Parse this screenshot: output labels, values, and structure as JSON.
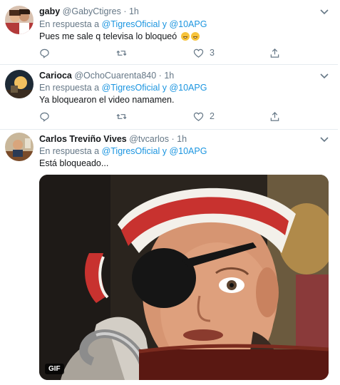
{
  "tweets": [
    {
      "name": "gaby",
      "handle": "@GabyCtigres",
      "dot": "·",
      "time": "1h",
      "reply_prefix": "En respuesta a ",
      "reply_links": "@TigresOficial y @10APG",
      "text": "Pues me sale q televisa lo bloqueó",
      "likes": "3"
    },
    {
      "name": "Carioca",
      "handle": "@OchoCuarenta840",
      "dot": "·",
      "time": "1h",
      "reply_prefix": "En respuesta a ",
      "reply_links": "@TigresOficial y @10APG",
      "text": "Ya bloquearon el video namamen.",
      "likes": "2"
    },
    {
      "name": "Carlos Treviño Vives",
      "handle": "@tvcarlos",
      "dot": "·",
      "time": "1h",
      "reply_prefix": "En respuesta a ",
      "reply_links": "@TigresOficial y @10APG",
      "text": "Está bloqueado...",
      "likes": "",
      "media_badge": "GIF"
    }
  ],
  "icons": {
    "reply": "reply-icon",
    "retweet": "retweet-icon",
    "like": "heart-icon",
    "share": "share-icon",
    "menu": "chevron-down-icon"
  },
  "colors": {
    "link": "#1b95e0",
    "secondary_text": "#657786",
    "divider": "#e6ecf0"
  }
}
